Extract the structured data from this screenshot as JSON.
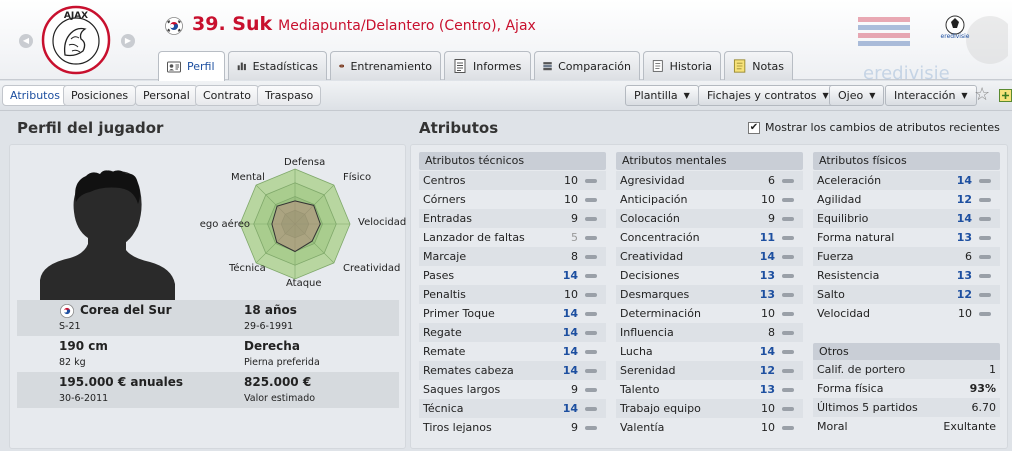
{
  "header": {
    "club_name": "AJAX",
    "player_title": "39. Suk",
    "player_positions": "Mediapunta/Delantero (Centro), Ajax",
    "league_watermark": "eredivisie",
    "nav_prev": "◀",
    "nav_next": "▶"
  },
  "tabs": [
    {
      "label": "Perfil",
      "icon": "profile-card-icon",
      "active": true
    },
    {
      "label": "Estadísticas",
      "icon": "bar-chart-icon"
    },
    {
      "label": "Entrenamiento",
      "icon": "rugby-ball-icon"
    },
    {
      "label": "Informes",
      "icon": "report-icon"
    },
    {
      "label": "Comparación",
      "icon": "compare-icon"
    },
    {
      "label": "Historia",
      "icon": "history-icon"
    },
    {
      "label": "Notas",
      "icon": "notes-icon"
    }
  ],
  "subtabs": [
    {
      "label": "Atributos",
      "active": true
    },
    {
      "label": "Posiciones"
    },
    {
      "label": "Personal"
    },
    {
      "label": "Contrato"
    },
    {
      "label": "Traspaso"
    }
  ],
  "actions": {
    "plantilla": "Plantilla",
    "fichajes": "Fichajes y contratos",
    "ojeo": "Ojeo",
    "interaccion": "Interacción",
    "star_icon": "☆"
  },
  "profile": {
    "heading": "Perfil del jugador",
    "radar_labels": {
      "defensa": "Defensa",
      "fisico": "Físico",
      "velocidad": "Velocidad",
      "creatividad": "Creatividad",
      "ataque": "Ataque",
      "tecnica": "Técnica",
      "juego_aereo": "Juego aéreo",
      "mental": "Mental"
    },
    "radar_values": {
      "defensa": 0.42,
      "fisico": 0.48,
      "velocidad": 0.46,
      "creatividad": 0.44,
      "ataque": 0.5,
      "tecnica": 0.47,
      "juego_aereo": 0.42,
      "mental": 0.46
    },
    "nationality": "Corea del Sur",
    "nat_sub": "S-21",
    "age": "18 años",
    "birthdate": "29-6-1991",
    "height": "190 cm",
    "weight": "82 kg",
    "foot": "Derecha",
    "foot_label": "Pierna preferida",
    "wage": "195.000 € anuales",
    "contract_end": "30-6-2011",
    "value": "825.000 €",
    "value_label": "Valor estimado"
  },
  "attributes": {
    "heading": "Atributos",
    "show_changes_label": "Mostrar los cambios de atributos recientes",
    "show_changes_checked": "✔",
    "technical": {
      "title": "Atributos técnicos",
      "rows": [
        {
          "name": "Centros",
          "value": "10"
        },
        {
          "name": "Córners",
          "value": "10"
        },
        {
          "name": "Entradas",
          "value": "9"
        },
        {
          "name": "Lanzador de faltas",
          "value": "5"
        },
        {
          "name": "Marcaje",
          "value": "8"
        },
        {
          "name": "Pases",
          "value": "14"
        },
        {
          "name": "Penaltis",
          "value": "10"
        },
        {
          "name": "Primer Toque",
          "value": "14"
        },
        {
          "name": "Regate",
          "value": "14"
        },
        {
          "name": "Remate",
          "value": "14"
        },
        {
          "name": "Remates cabeza",
          "value": "14"
        },
        {
          "name": "Saques largos",
          "value": "9"
        },
        {
          "name": "Técnica",
          "value": "14"
        },
        {
          "name": "Tiros lejanos",
          "value": "9"
        }
      ]
    },
    "mental": {
      "title": "Atributos mentales",
      "rows": [
        {
          "name": "Agresividad",
          "value": "6"
        },
        {
          "name": "Anticipación",
          "value": "10"
        },
        {
          "name": "Colocación",
          "value": "9"
        },
        {
          "name": "Concentración",
          "value": "11"
        },
        {
          "name": "Creatividad",
          "value": "14"
        },
        {
          "name": "Decisiones",
          "value": "13"
        },
        {
          "name": "Desmarques",
          "value": "13"
        },
        {
          "name": "Determinación",
          "value": "10"
        },
        {
          "name": "Influencia",
          "value": "8"
        },
        {
          "name": "Lucha",
          "value": "14"
        },
        {
          "name": "Serenidad",
          "value": "12"
        },
        {
          "name": "Talento",
          "value": "13"
        },
        {
          "name": "Trabajo equipo",
          "value": "10"
        },
        {
          "name": "Valentía",
          "value": "10"
        }
      ]
    },
    "physical": {
      "title": "Atributos físicos",
      "rows": [
        {
          "name": "Aceleración",
          "value": "14"
        },
        {
          "name": "Agilidad",
          "value": "12"
        },
        {
          "name": "Equilibrio",
          "value": "14"
        },
        {
          "name": "Forma natural",
          "value": "13"
        },
        {
          "name": "Fuerza",
          "value": "6"
        },
        {
          "name": "Resistencia",
          "value": "13"
        },
        {
          "name": "Salto",
          "value": "12"
        },
        {
          "name": "Velocidad",
          "value": "10"
        }
      ]
    },
    "otros": {
      "title": "Otros",
      "rows": [
        {
          "name": "Calif. de portero",
          "value": "1"
        },
        {
          "name": "Forma física",
          "value": "93%"
        },
        {
          "name": "Últimos 5 partidos",
          "value": "6.70"
        },
        {
          "name": "Moral",
          "value": "Exultante"
        }
      ]
    }
  }
}
